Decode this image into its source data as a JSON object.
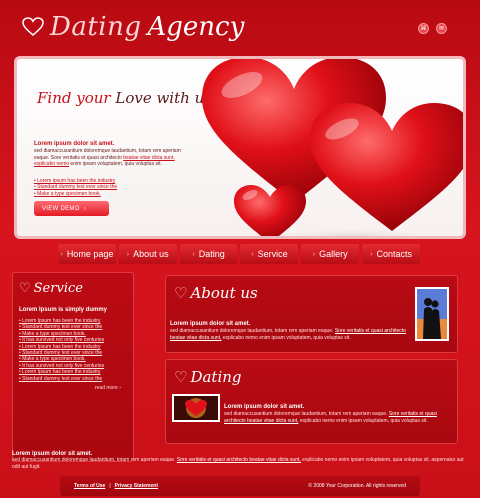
{
  "brand": {
    "word1": "Dating",
    "word2": "Agency"
  },
  "top_icons": [
    "rss-icon",
    "bookmark-icon"
  ],
  "hero": {
    "tagline_part1": "Find your",
    "tagline_part2": "Love with us!",
    "heading": "Lorem ipsum dolor sit amet.",
    "para_before_link": "sed diamaccusantium doloremque laudantium, totam rem aperiam eaque. Sore veritatis et quasi architecto",
    "para_link": "beatae vitae dicta sunt, explicabo nemo",
    "para_after_link": "enim ipsam voluptatem, quia voluptas sit.",
    "links": [
      "Lorem ipsum has been the industry",
      "Standard dummy text ever since the",
      "Make a type specimen book."
    ],
    "button": "VIEW DEMO"
  },
  "nav": [
    {
      "label": "Home page"
    },
    {
      "label": "About us"
    },
    {
      "label": "Dating"
    },
    {
      "label": "Service"
    },
    {
      "label": "Gallery"
    },
    {
      "label": "Contacts"
    }
  ],
  "service": {
    "title": "Service",
    "heading": "Lorem Ipsum is simply dummy",
    "items": [
      "Lorem Ipsum has been the industry",
      "Standard dummy text ever since the",
      "Make a type specimen book.",
      "It has survived not only five centuries",
      "Lorem Ipsum has been the industry",
      "Standard dummy text ever since the",
      "Make a type specimen book.",
      "It has survived not only five centuries",
      "Lorem Ipsum has been the industry",
      "Standard dummy text ever since the"
    ],
    "more": "read more"
  },
  "about": {
    "title": "About us",
    "heading": "Lorem ipsum dolor sit amet.",
    "para_before_link": "sed diamaccusantium doloremque laudantium, totam rem aperiam eaque.",
    "para_link": "Sore veritatis et quasi architecto beatae vitae dicta sunt,",
    "para_after_link": "explicabo nemo enim ipsam voluptatem, quia voluptas sit."
  },
  "dating": {
    "title": "Dating",
    "heading": "Lorem ipsum dolor sit amet.",
    "para_before_link": "sed diamaccusantium doloremque laudantium, totam rem aperiam eaque.",
    "para_link": "Sore veritatis et quasi architecto beatae vitae dicta sunt,",
    "para_after_link": "explicabo nemo enim ipsam voluptatem, quia voluptas sit."
  },
  "bottom": {
    "heading": "Lorem ipsum dolor sit amet.",
    "para_before_link": "sed diamaccusantium doloremque laudantium, totam rem aperiam eaque.",
    "para_link": "Sore veritatis et quasi architecto beatae vitae dicta sunt,",
    "para_after_link": "explicabo nemo enim ipsam voluptatem, quia voluptas sit. aspernatur aut odit aut fugit."
  },
  "footer": {
    "terms": "Terms of Use",
    "separator": "|",
    "privacy": "Privacy Statement",
    "copyright": "© 2008 Your Corporation. All rights reserved"
  },
  "colors": {
    "accent": "#c8101a",
    "panel": "#b10911",
    "hero_bg": "#ffffff"
  }
}
